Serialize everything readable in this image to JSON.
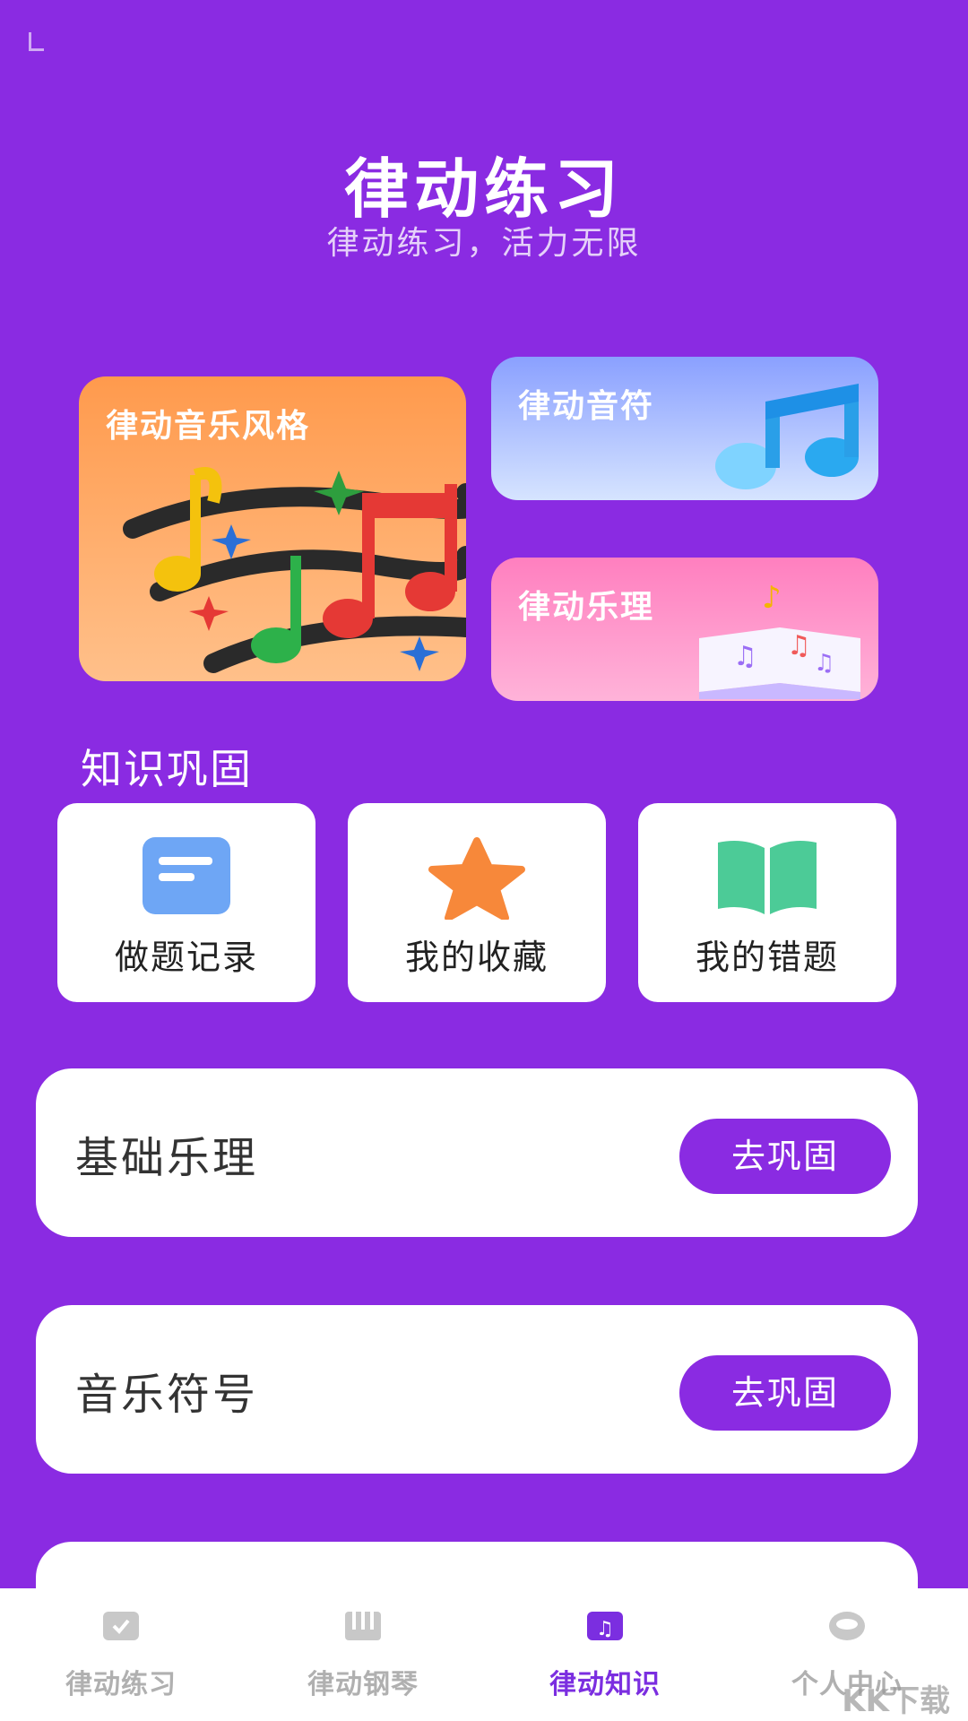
{
  "header": {
    "title": "律动练习",
    "subtitle": "律动练习，活力无限"
  },
  "cards": {
    "style": "律动音乐风格",
    "notes": "律动音符",
    "theory": "律动乐理"
  },
  "knowledge": {
    "title": "知识巩固",
    "tiles": [
      {
        "label": "做题记录",
        "icon": "document-icon"
      },
      {
        "label": "我的收藏",
        "icon": "star-icon"
      },
      {
        "label": "我的错题",
        "icon": "book-icon"
      }
    ]
  },
  "practice": [
    {
      "label": "基础乐理",
      "button": "去巩固"
    },
    {
      "label": "音乐符号",
      "button": "去巩固"
    },
    {
      "label": "",
      "button": ""
    }
  ],
  "tabbar": {
    "items": [
      {
        "label": "律动练习",
        "active": false
      },
      {
        "label": "律动钢琴",
        "active": false
      },
      {
        "label": "律动知识",
        "active": true
      },
      {
        "label": "个人中心",
        "active": false
      }
    ]
  },
  "watermark": "KK下载",
  "colors": {
    "background": "#8a2be2",
    "accent": "#7b2ee0",
    "button": "#8a2be2"
  }
}
